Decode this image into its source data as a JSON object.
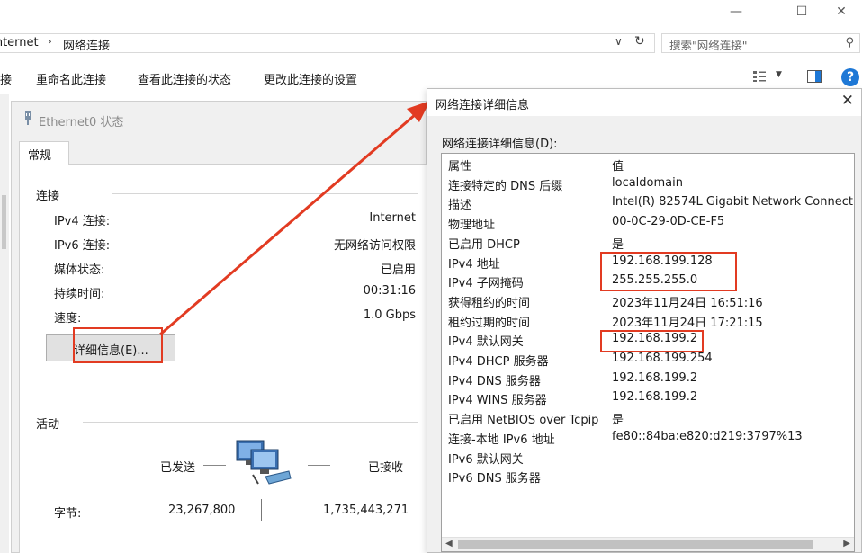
{
  "window": {
    "minimize_icon": "minimize-icon",
    "maximize_icon": "maximize-icon",
    "close_icon": "close-icon"
  },
  "address": {
    "parent": "Internet",
    "separator": "›",
    "current": "网络连接",
    "search_placeholder": "搜索\"网络连接\""
  },
  "commands": {
    "partial": "接",
    "rename": "重命名此连接",
    "view_status": "查看此连接的状态",
    "change_settings": "更改此连接的设置"
  },
  "status_dialog": {
    "title": "Ethernet0 状态",
    "tab": "常规",
    "connection_group": "连接",
    "rows": [
      {
        "label": "IPv4 连接:",
        "value": "Internet"
      },
      {
        "label": "IPv6 连接:",
        "value": "无网络访问权限"
      },
      {
        "label": "媒体状态:",
        "value": "已启用"
      },
      {
        "label": "持续时间:",
        "value": "00:31:16"
      },
      {
        "label": "速度:",
        "value": "1.0 Gbps"
      }
    ],
    "details_button": "详细信息(E)...",
    "activity_group": "活动",
    "sent_label": "已发送",
    "received_label": "已接收",
    "bytes_label": "字节:",
    "bytes_sent": "23,267,800",
    "bytes_received": "1,735,443,271"
  },
  "details_dialog": {
    "title": "网络连接详细信息",
    "caption": "网络连接详细信息(D):",
    "header_property": "属性",
    "header_value": "值",
    "rows": [
      {
        "property": "连接特定的 DNS 后缀",
        "value": "localdomain"
      },
      {
        "property": "描述",
        "value": "Intel(R) 82574L Gigabit Network Connect"
      },
      {
        "property": "物理地址",
        "value": "00-0C-29-0D-CE-F5"
      },
      {
        "property": "已启用 DHCP",
        "value": "是"
      },
      {
        "property": "IPv4 地址",
        "value": "192.168.199.128"
      },
      {
        "property": "IPv4 子网掩码",
        "value": "255.255.255.0"
      },
      {
        "property": "获得租约的时间",
        "value": "2023年11月24日 16:51:16"
      },
      {
        "property": "租约过期的时间",
        "value": "2023年11月24日 17:21:15"
      },
      {
        "property": "IPv4 默认网关",
        "value": "192.168.199.2"
      },
      {
        "property": "IPv4 DHCP 服务器",
        "value": "192.168.199.254"
      },
      {
        "property": "IPv4 DNS 服务器",
        "value": "192.168.199.2"
      },
      {
        "property": "IPv4 WINS 服务器",
        "value": "192.168.199.2"
      },
      {
        "property": "已启用 NetBIOS over Tcpip",
        "value": "是"
      },
      {
        "property": "连接-本地 IPv6 地址",
        "value": "fe80::84ba:e820:d219:3797%13"
      },
      {
        "property": "IPv6 默认网关",
        "value": ""
      },
      {
        "property": "IPv6 DNS 服务器",
        "value": ""
      }
    ]
  },
  "colors": {
    "highlight_red": "#e23b22",
    "help_blue": "#1e78d6",
    "dialog_bg": "#f0f0f0"
  }
}
